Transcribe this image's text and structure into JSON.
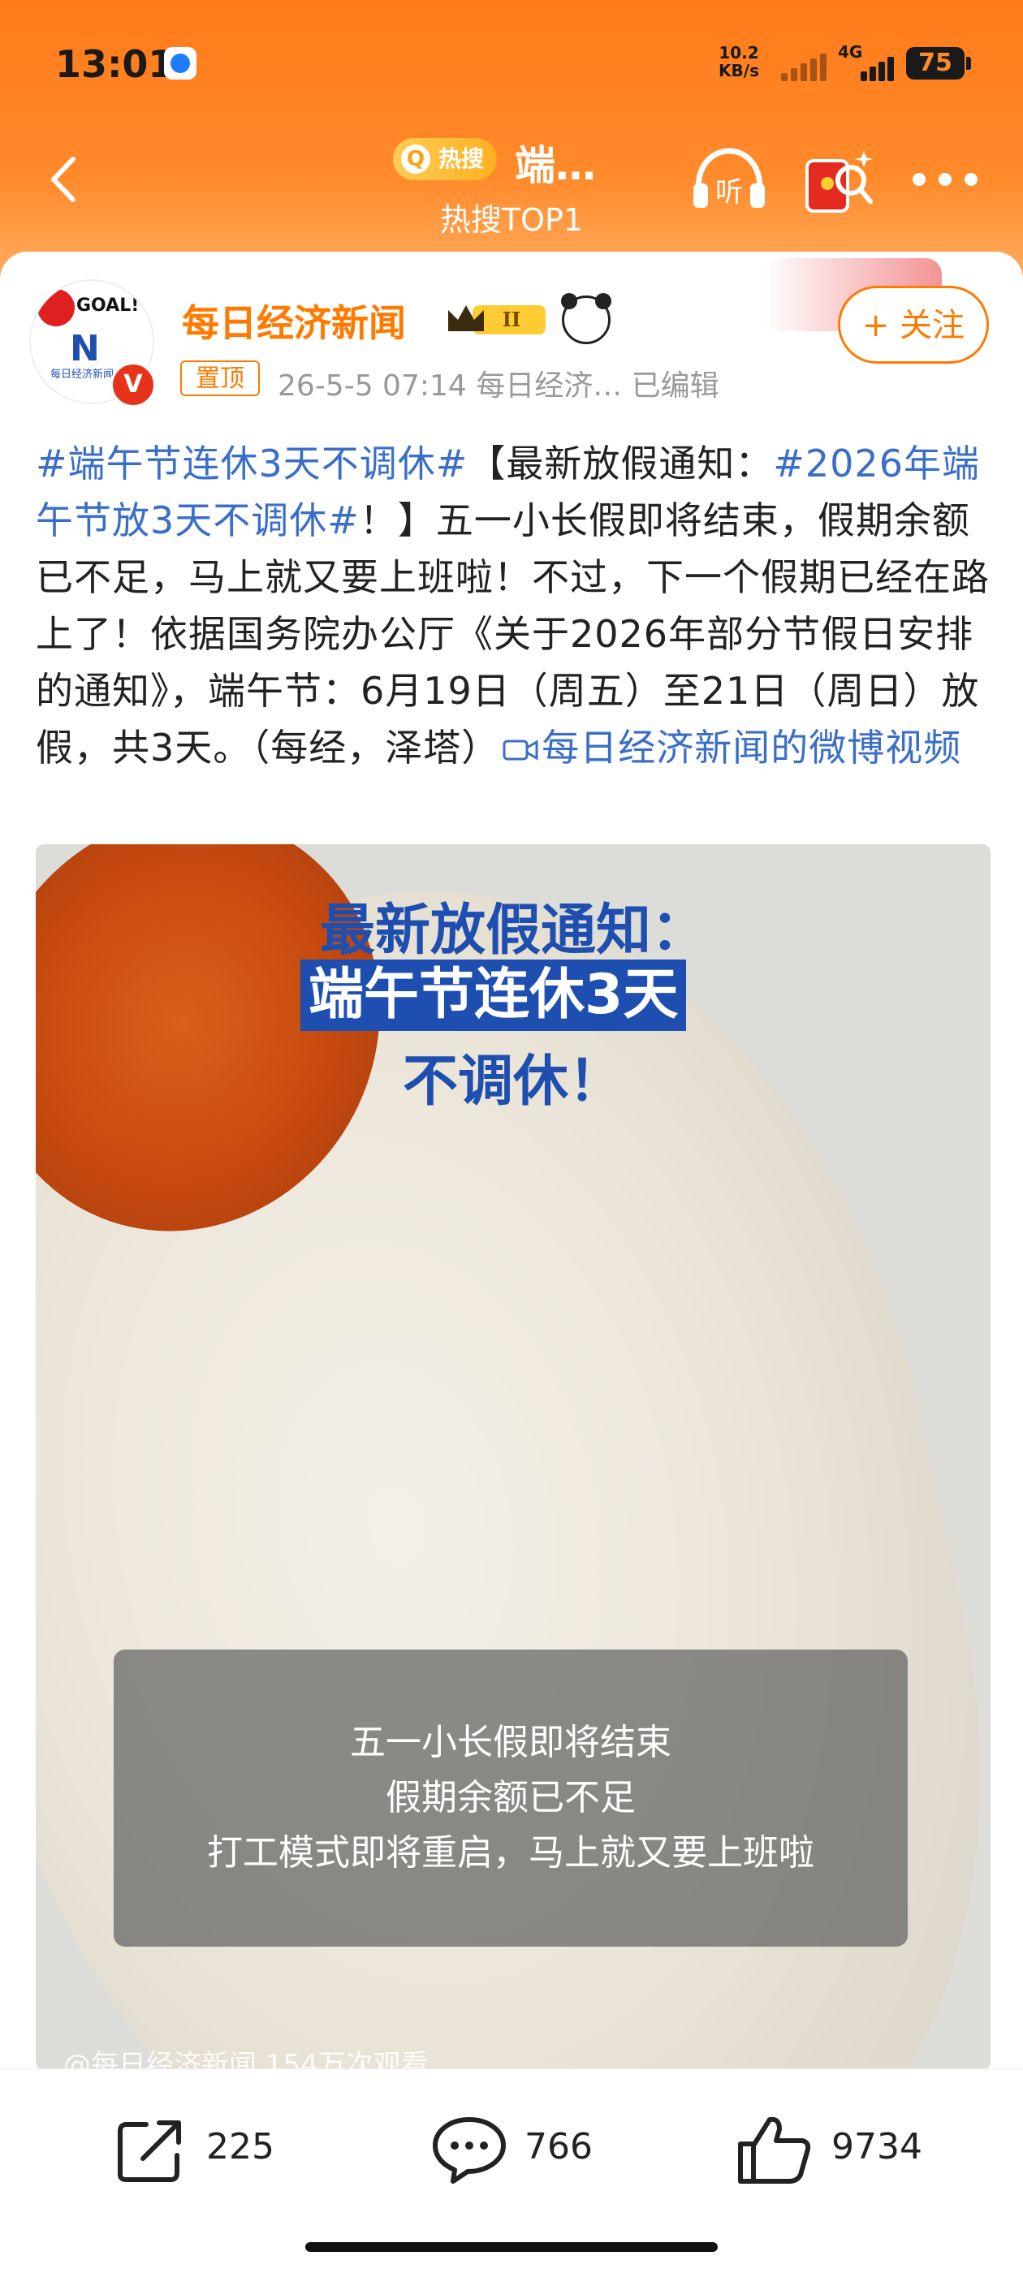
{
  "status_bar": {
    "time": "13:01",
    "net_speed_value": "10.2",
    "net_speed_unit": "KB/s",
    "network": "4G",
    "battery": "75"
  },
  "nav": {
    "hot_badge": "热搜",
    "title": "端…",
    "subtitle": "热搜TOP1",
    "icons": [
      "back-icon",
      "listen-icon",
      "red-packet-icon",
      "more-icon"
    ],
    "listen_label": "听"
  },
  "post": {
    "author": "每日经济新闻",
    "verified_mark": "V",
    "level_badge": "II",
    "follow_label": "+ 关注",
    "pin_label": "置顶",
    "meta": "26-5-5 07:14  每日经济…  已编辑",
    "avatar_text": {
      "goal": "GOAL!",
      "mark": "N",
      "cn": "每日经济新闻"
    },
    "content": {
      "tag1": "#端午节连休3天不调休#",
      "part1": "【最新放假通知：",
      "tag2": "#2026年端午节放3天不调休#",
      "part2": "！】五一小长假即将结束，假期余额已不足，马上就又要上班啦！不过，下一个假期已经在路上了！依据国务院办公厅《关于2026年部分节假日安排的通知》，端午节：6月19日（周五）至21日（周日）放假，共3天。（每经，泽塔）",
      "video_link": "每日经济新闻的微博视频"
    },
    "video": {
      "title_line1": "最新放假通知：",
      "title_line2": "端午节连休3天",
      "title_line3": "不调休！",
      "caption_line1": "五一小长假即将结束",
      "caption_line2": "假期余额已不足",
      "caption_line3": "打工模式即将重启，马上就又要上班啦",
      "footer": "@每日经济新闻 154万次观看"
    }
  },
  "actions": {
    "share_count": "225",
    "comment_count": "766",
    "like_count": "9734"
  },
  "colors": {
    "header": "#ff7a1a",
    "accent": "#ff7a00",
    "link": "#3a6ec8",
    "video_title": "#1e4fb0"
  }
}
